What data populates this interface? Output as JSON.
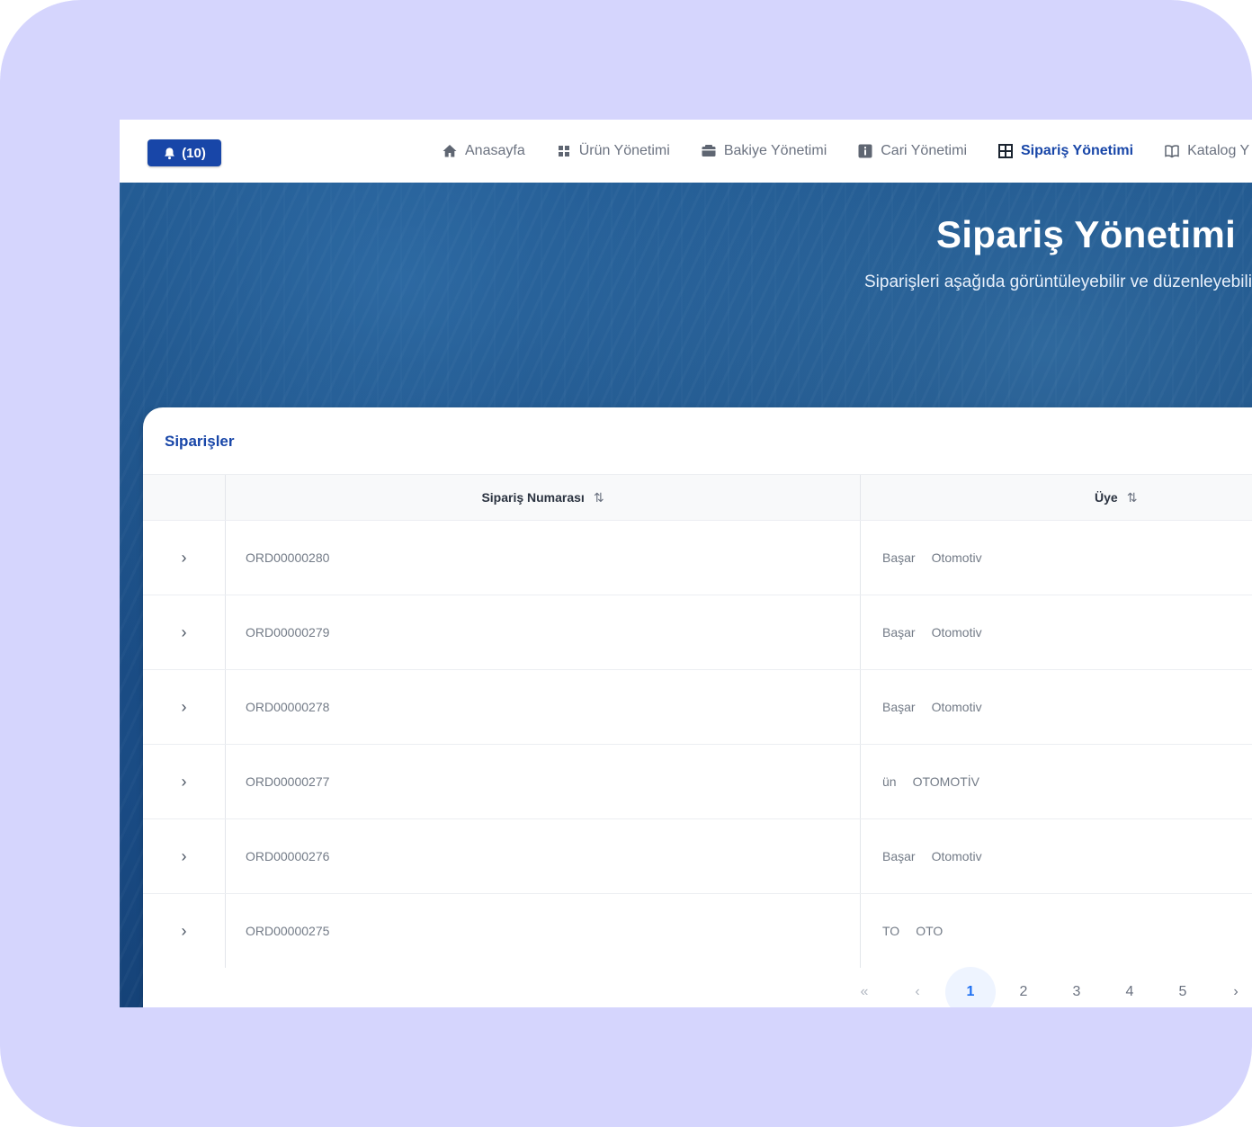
{
  "topbar": {
    "notification_label": "(10)",
    "nav": [
      {
        "label": "Anasayfa",
        "icon": "home-icon",
        "active": false
      },
      {
        "label": "Ürün Yönetimi",
        "icon": "grid-icon",
        "active": false
      },
      {
        "label": "Bakiye Yönetimi",
        "icon": "wallet-icon",
        "active": false
      },
      {
        "label": "Cari Yönetimi",
        "icon": "info-icon",
        "active": false
      },
      {
        "label": "Sipariş Yönetimi",
        "icon": "table-icon",
        "active": true
      },
      {
        "label": "Katalog Y",
        "icon": "book-icon",
        "active": false
      }
    ]
  },
  "hero": {
    "title": "Sipariş Yönetimi",
    "subtitle": "Siparişleri aşağıda görüntüleyebilir ve düzenleyebili"
  },
  "orders": {
    "title": "Siparişler",
    "columns": [
      "Sipariş Numarası",
      "Üye"
    ],
    "sort_icon": "⇅",
    "rows": [
      {
        "order_no": "ORD00000280",
        "member_first": "Başar",
        "member_last": "Otomotiv"
      },
      {
        "order_no": "ORD00000279",
        "member_first": "Başar",
        "member_last": "Otomotiv"
      },
      {
        "order_no": "ORD00000278",
        "member_first": "Başar",
        "member_last": "Otomotiv"
      },
      {
        "order_no": "ORD00000277",
        "member_first": "ün",
        "member_last": "OTOMOTİV"
      },
      {
        "order_no": "ORD00000276",
        "member_first": "Başar",
        "member_last": "Otomotiv"
      },
      {
        "order_no": "ORD00000275",
        "member_first": "TO",
        "member_last": "OTO"
      }
    ]
  },
  "pagination": {
    "first": "«",
    "prev": "‹",
    "pages": [
      "1",
      "2",
      "3",
      "4",
      "5"
    ],
    "current": "1",
    "next": "›"
  },
  "colors": {
    "accent": "#1846a8",
    "frame": "#d5d5fd",
    "hero": "#16467a",
    "active_page": "#1d6ff2"
  }
}
